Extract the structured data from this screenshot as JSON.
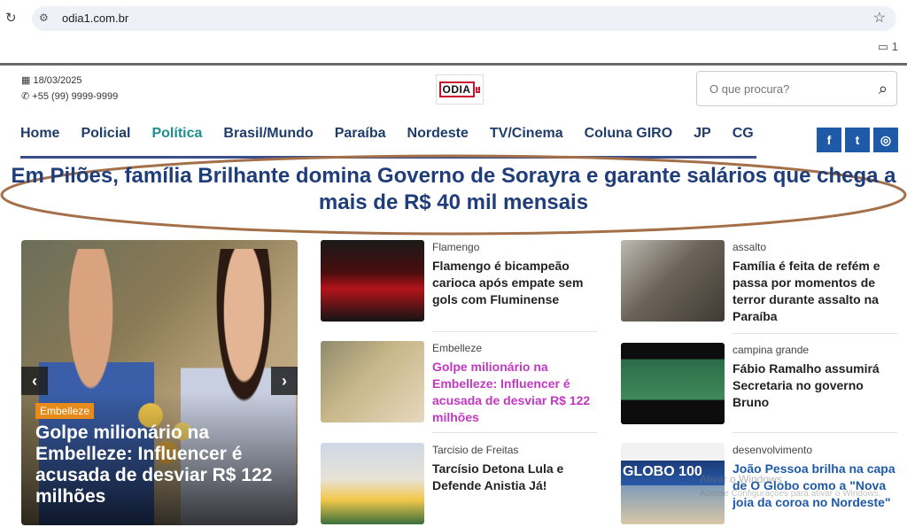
{
  "browser": {
    "url": "odia1.com.br",
    "reload_icon": "reload-icon",
    "bookmark_icon": "star-icon",
    "folder_icon": "folder-icon"
  },
  "header": {
    "date": "18/03/2025",
    "phone": "+55 (99) 9999-9999",
    "logo_text": "ODIA",
    "logo_sup": "1",
    "search_placeholder": "O que procura?"
  },
  "nav": {
    "items": [
      {
        "label": "Home",
        "active": false
      },
      {
        "label": "Policial",
        "active": false
      },
      {
        "label": "Política",
        "active": true
      },
      {
        "label": "Brasil/Mundo",
        "active": false
      },
      {
        "label": "Paraíba",
        "active": false
      },
      {
        "label": "Nordeste",
        "active": false
      },
      {
        "label": "TV/Cinema",
        "active": false
      },
      {
        "label": "Coluna GIRO",
        "active": false
      },
      {
        "label": "JP",
        "active": false
      },
      {
        "label": "CG",
        "active": false
      }
    ]
  },
  "social": {
    "facebook": "f",
    "twitter": "t",
    "instagram": "◎"
  },
  "headline": "Em Pilões, família Brilhante domina Governo de Sorayra e garante salários que chega a mais de R$ 40 mil mensais",
  "slider": {
    "badge": "Embelleze",
    "title": "Golpe milionário na Embelleze: Influencer é acusada de desviar R$ 122 milhões"
  },
  "middle_articles": [
    {
      "category": "Flamengo",
      "title": "Flamengo é bicampeão carioca após empate sem gols com Fluminense"
    },
    {
      "category": "Embelleze",
      "title": "Golpe milionário na Embelleze: Influencer é acusada de desviar R$ 122 milhões"
    },
    {
      "category": "Tarcisio de Freitas",
      "title": "Tarcísio Detona Lula e Defende Anistia Já!"
    }
  ],
  "right_articles": [
    {
      "category": "assalto",
      "title": "Família é feita de refém e passa por momentos de terror durante assalto na Paraíba"
    },
    {
      "category": "campina grande",
      "title": "Fábio Ramalho assumirá Secretaria no governo Bruno"
    },
    {
      "category": "desenvolvimento",
      "title": "João Pessoa brilha na capa de O Globo como a \"Nova joia da coroa no Nordeste\""
    }
  ],
  "globo_thumb_text": "GLOBO 100",
  "watermark": "Ativar o Windows",
  "watermark_sub": "Acesse Configurações para ativar o Windows."
}
